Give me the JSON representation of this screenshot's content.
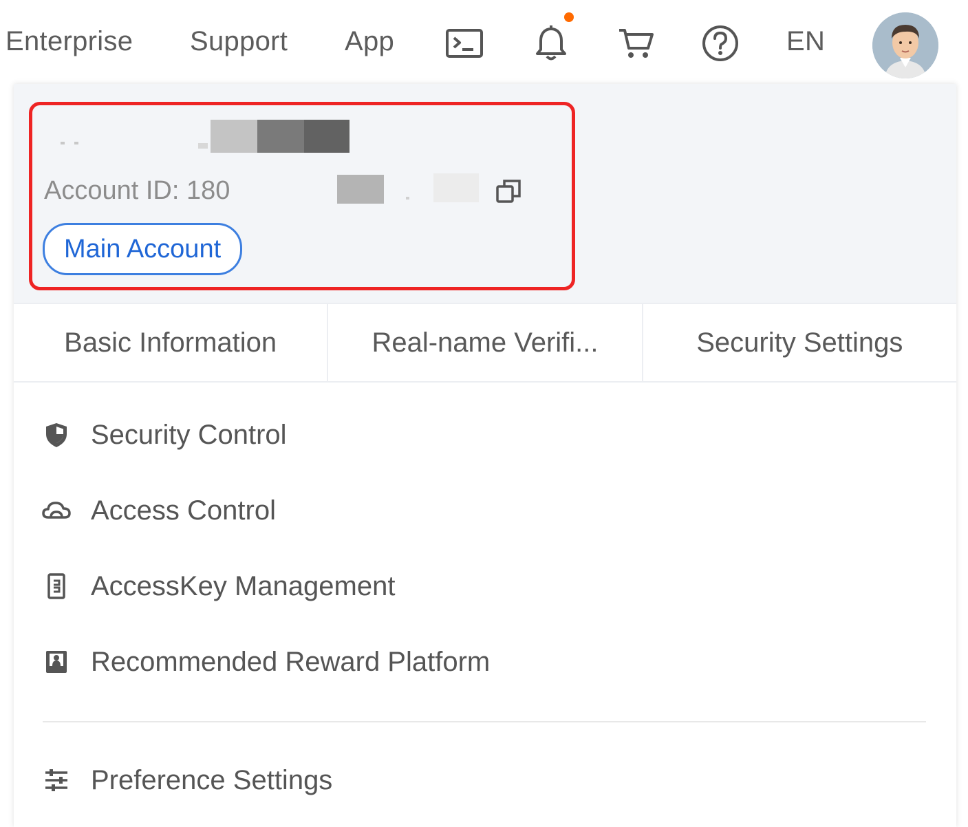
{
  "nav": {
    "enterprise": "Enterprise",
    "support": "Support",
    "app": "App",
    "language": "EN",
    "icons": {
      "terminal": "terminal-icon",
      "notifications": "bell-icon",
      "cart": "cart-icon",
      "help": "help-icon",
      "avatar": "avatar"
    },
    "notification_dot_color": "#ff6a00"
  },
  "account": {
    "id_label": "Account ID: 180",
    "type_tag": "Main Account",
    "highlight_color": "#ee2424",
    "tag_color": "#1f66d6"
  },
  "tabs": [
    {
      "label": "Basic Information"
    },
    {
      "label": "Real-name Verifi..."
    },
    {
      "label": "Security Settings"
    }
  ],
  "menu": {
    "items": [
      {
        "label": "Security Control",
        "icon": "shield-icon"
      },
      {
        "label": "Access Control",
        "icon": "cloud-icon"
      },
      {
        "label": "AccessKey Management",
        "icon": "key-icon"
      },
      {
        "label": "Recommended Reward Platform",
        "icon": "reward-icon"
      }
    ],
    "footer_items": [
      {
        "label": "Preference Settings",
        "icon": "sliders-icon"
      }
    ]
  }
}
